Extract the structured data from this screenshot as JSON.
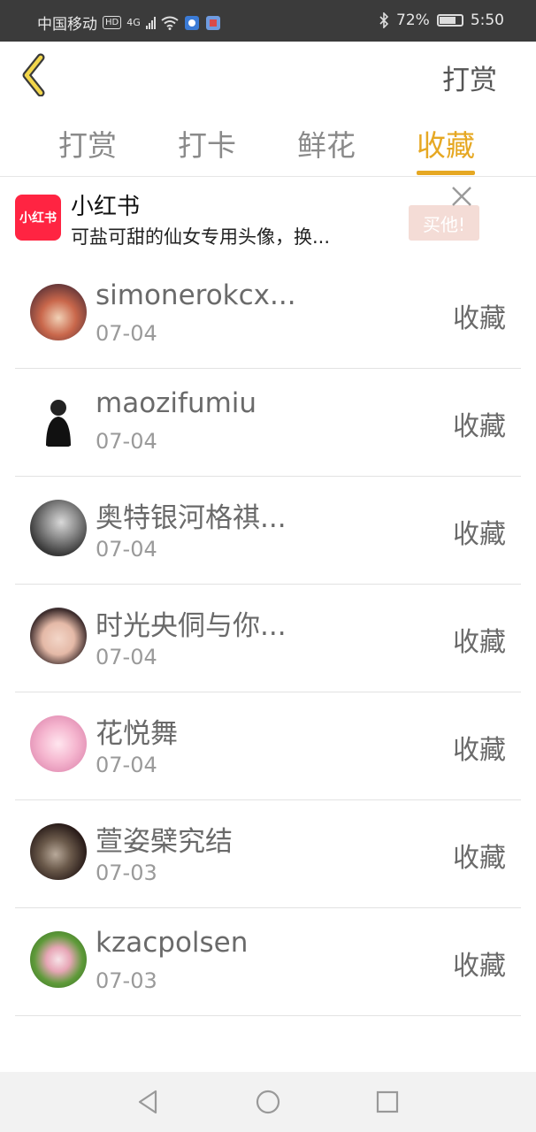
{
  "status_bar": {
    "carrier": "中国移动",
    "hd_badge": "HD",
    "network": "4G",
    "battery_pct": "72%",
    "time": "5:50"
  },
  "header": {
    "back_icon": "chevron-left-icon",
    "action_label": "打赏"
  },
  "tabs": [
    {
      "label": "打赏",
      "active": false
    },
    {
      "label": "打卡",
      "active": false
    },
    {
      "label": "鲜花",
      "active": false
    },
    {
      "label": "收藏",
      "active": true
    }
  ],
  "ad": {
    "logo_text": "小红书",
    "title": "小红书",
    "description": "可盐可甜的仙女专用头像，换...",
    "buy_label": "买他!"
  },
  "entries": [
    {
      "name": "simonerokcx...",
      "date": "07-04",
      "action": "收藏"
    },
    {
      "name": "maozifumiu",
      "date": "07-04",
      "action": "收藏"
    },
    {
      "name": "奥特银河格祺...",
      "date": "07-04",
      "action": "收藏"
    },
    {
      "name": "时光央侗与你...",
      "date": "07-04",
      "action": "收藏"
    },
    {
      "name": "花悦舞",
      "date": "07-04",
      "action": "收藏"
    },
    {
      "name": "萱姿檗究结",
      "date": "07-03",
      "action": "收藏"
    },
    {
      "name": "kzacpolsen",
      "date": "07-03",
      "action": "收藏"
    }
  ],
  "colors": {
    "accent": "#e6a823",
    "status_bar_bg": "#3b3b3b",
    "ad_logo": "#ff2442"
  }
}
